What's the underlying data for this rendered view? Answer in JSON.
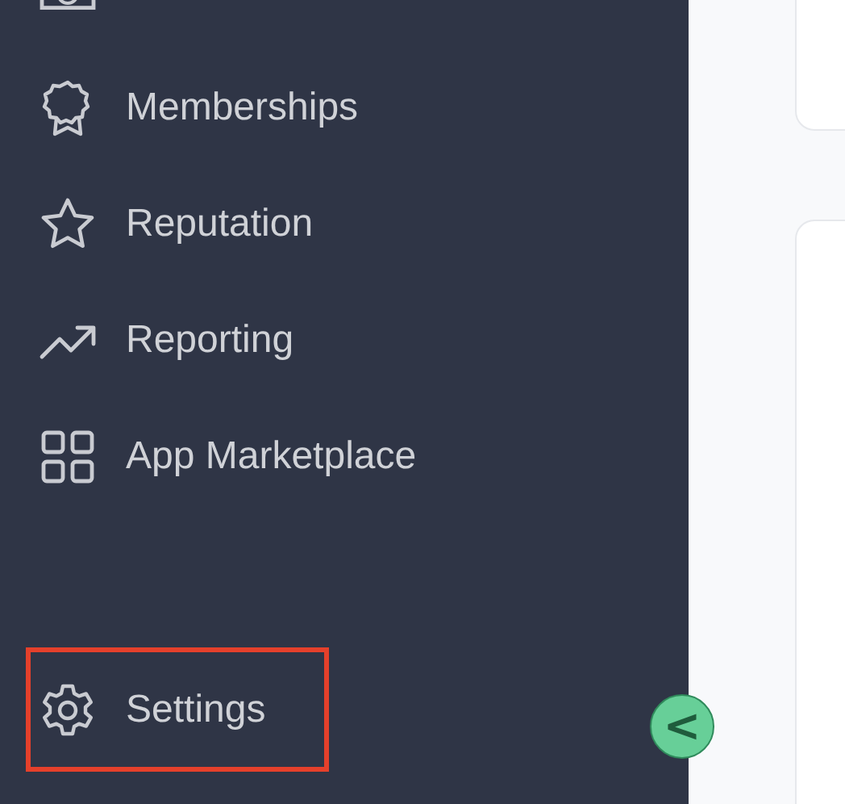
{
  "sidebar": {
    "items": [
      {
        "label": "Memberships",
        "highlighted": false
      },
      {
        "label": "Reputation",
        "highlighted": false
      },
      {
        "label": "Reporting",
        "highlighted": false
      },
      {
        "label": "App Marketplace",
        "highlighted": false
      }
    ],
    "footer_items": [
      {
        "label": "Settings",
        "highlighted": true
      }
    ]
  },
  "collapse_button": {
    "symbol": "<"
  }
}
